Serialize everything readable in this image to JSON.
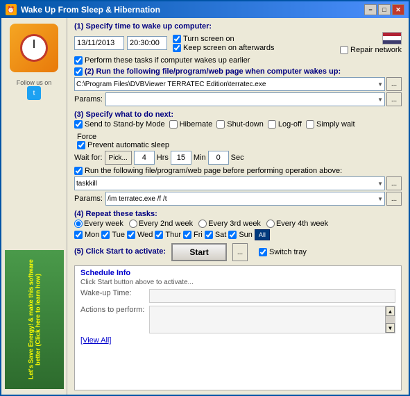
{
  "window": {
    "title": "Wake Up From Sleep & Hibernation",
    "minimize": "−",
    "maximize": "□",
    "close": "✕"
  },
  "section1": {
    "label": "(1) Specify time to wake up computer:",
    "date": "13/11/2013",
    "time": "20:30:00",
    "turn_screen_on": "Turn screen on",
    "keep_screen": "Keep screen on afterwards",
    "repair_network": "Repair network",
    "perform_tasks": "Perform these tasks if computer wakes up earlier"
  },
  "section2": {
    "label": "(2) Run the following file/program/web page when computer wakes up:",
    "path": "C:\\Program Files\\DVBViewer TERRATEC Edition\\terratec.exe",
    "params_label": "Params:",
    "params_value": "",
    "browse": "..."
  },
  "section3": {
    "label": "(3) Specify what to do next:",
    "send_standby": "Send to Stand-by Mode",
    "hibernate": "Hibernate",
    "shutdown": "Shut-down",
    "logoff": "Log-off",
    "simply_wait": "Simply wait",
    "force": "Force",
    "prevent_sleep": "Prevent automatic sleep",
    "wait_for": "Wait for:",
    "pick": "Pick...",
    "hrs_val": "4",
    "hrs_label": "Hrs",
    "min_val": "15",
    "min_label": "Min",
    "sec_val": "0",
    "sec_label": "Sec",
    "run_file": "Run the following file/program/web page before performing operation above:",
    "file_path": "taskkill",
    "params_label": "Params:",
    "params_value": "/im terratec.exe /f /t"
  },
  "section4": {
    "label": "(4) Repeat these tasks:",
    "every_week": "Every week",
    "every_2nd": "Every 2nd week",
    "every_3rd": "Every 3rd week",
    "every_4th": "Every 4th week",
    "mon": "Mon",
    "tue": "Tue",
    "wed": "Wed",
    "thu": "Thur",
    "fri": "Fri",
    "sat": "Sat",
    "sun": "Sun",
    "all": "All"
  },
  "section5": {
    "label": "(5) Click Start to activate:",
    "start": "Start",
    "browse": "...",
    "switch_tray": "Switch tray"
  },
  "schedule": {
    "title": "Schedule Info",
    "hint": "Click Start button above to activate...",
    "wakeup_label": "Wake-up Time:",
    "actions_label": "Actions to perform:",
    "view_all": "[View All]"
  },
  "sidebar": {
    "follow_us": "Follow us on",
    "energy_text": "Let's Save Energy! & make this software better (Click here to learn how)"
  }
}
